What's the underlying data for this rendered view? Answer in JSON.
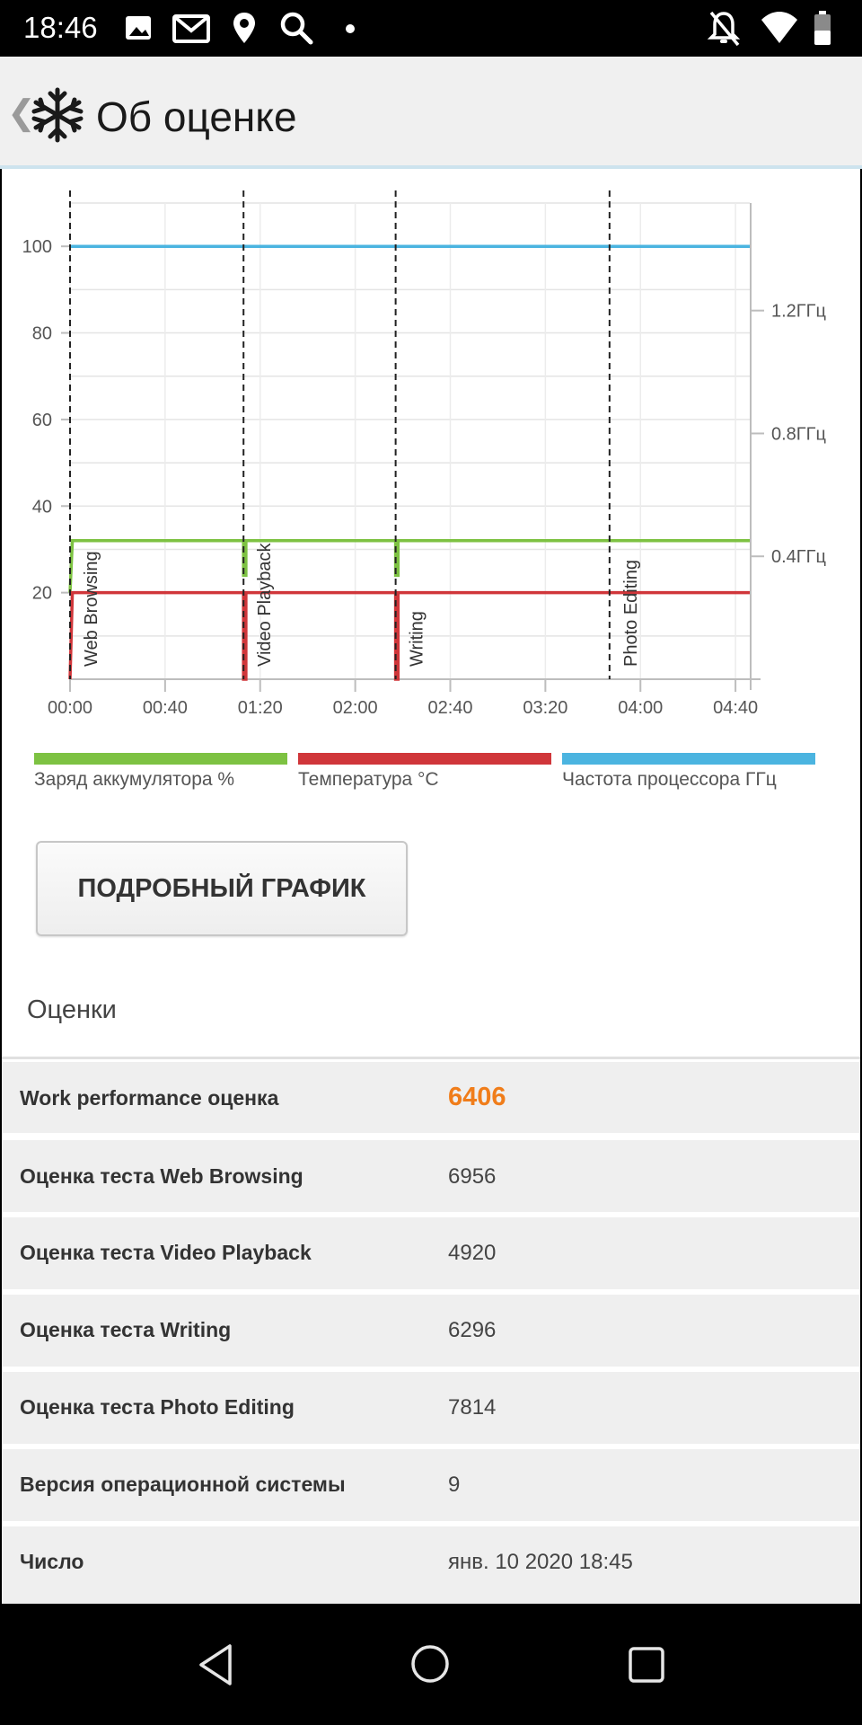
{
  "status_bar": {
    "time": "18:46",
    "left_icons": [
      "image-icon",
      "gmail-icon",
      "location-icon",
      "search-icon",
      "dot-icon"
    ],
    "right_icons": [
      "notifications-off-icon",
      "wifi-icon",
      "battery-icon"
    ]
  },
  "app_bar": {
    "back_icon": "chevron-left-icon",
    "logo_icon": "snowflake-icon",
    "title": "Об оценке"
  },
  "chart_data": {
    "type": "line",
    "x_ticks": [
      "00:00",
      "00:40",
      "01:20",
      "02:00",
      "02:40",
      "03:20",
      "04:00",
      "04:40"
    ],
    "y_left_ticks": [
      "20",
      "40",
      "60",
      "80",
      "100"
    ],
    "y_right_ticks": [
      "0.4ГГц",
      "0.8ГГц",
      "1.2ГГц"
    ],
    "xlim_minutes": [
      0,
      286
    ],
    "ylim_left": [
      0,
      110
    ],
    "ylim_right_ghz": [
      0,
      1.55
    ],
    "grid": true,
    "markers": [
      {
        "label": "Web Browsing",
        "x_minutes": 0
      },
      {
        "label": "Video Playback",
        "x_minutes": 73
      },
      {
        "label": "Writing",
        "x_minutes": 137
      },
      {
        "label": "Photo Editing",
        "x_minutes": 227
      }
    ],
    "series": [
      {
        "name": "Заряд аккумулятора %",
        "color": "#7dc242",
        "axis": "left",
        "x_minutes": [
          0,
          1,
          1,
          73,
          73,
          74,
          74,
          137,
          137,
          138,
          138,
          286
        ],
        "y": [
          20,
          32,
          32,
          32,
          24,
          24,
          32,
          32,
          24,
          24,
          32,
          32
        ]
      },
      {
        "name": "Температура °C",
        "color": "#d0363a",
        "axis": "left",
        "x_minutes": [
          0,
          1,
          1,
          73,
          73,
          74,
          74,
          137,
          137,
          138,
          138,
          286
        ],
        "y": [
          0,
          20,
          20,
          20,
          0,
          0,
          20,
          20,
          0,
          0,
          20,
          20
        ]
      },
      {
        "name": "Частота процессора ГГц",
        "color": "#4bb4e0",
        "axis": "left",
        "x_minutes": [
          0,
          286
        ],
        "y": [
          100,
          100
        ]
      }
    ]
  },
  "detail_button": {
    "label": "ПОДРОБНЫЙ ГРАФИК"
  },
  "scores": {
    "title": "Оценки",
    "rows": [
      {
        "label": "Work performance оценка",
        "value": "6406",
        "highlight": true
      },
      {
        "label": "Оценка теста Web Browsing",
        "value": "6956"
      },
      {
        "label": "Оценка теста Video Playback",
        "value": "4920"
      },
      {
        "label": "Оценка теста Writing",
        "value": "6296"
      },
      {
        "label": "Оценка теста Photo Editing",
        "value": "7814"
      },
      {
        "label": "Версия операционной системы",
        "value": "9"
      },
      {
        "label": "Число",
        "value": "янв. 10 2020 18:45"
      }
    ]
  },
  "nav_bar": {
    "icons": [
      "back-triangle-icon",
      "home-circle-icon",
      "recents-square-icon"
    ]
  }
}
